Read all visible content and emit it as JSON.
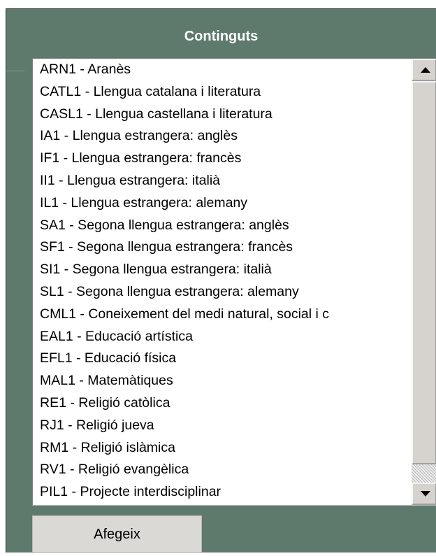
{
  "panel": {
    "title": "Continguts"
  },
  "list": {
    "items": [
      "ARN1 - Aranès",
      "CATL1 - Llengua catalana i literatura",
      "CASL1 - Llengua castellana i literatura",
      "IA1 - Llengua estrangera: anglès",
      "IF1 - Llengua estrangera: francès",
      "II1 - Llengua estrangera: italià",
      "IL1 - Llengua estrangera: alemany",
      "SA1 - Segona llengua estrangera: anglès",
      "SF1 - Segona llengua estrangera: francès",
      "SI1 - Segona llengua estrangera: italià",
      "SL1 - Segona llengua estrangera: alemany",
      "CML1 - Coneixement del medi natural, social i c",
      "EAL1 - Educació artística",
      "EFL1 - Educació física",
      "MAL1 - Matemàtiques",
      "RE1 - Religió catòlica",
      "RJ1 - Religió jueva",
      "RM1 - Religió islàmica",
      "RV1 - Religió evangèlica",
      "PIL1 - Projecte interdisciplinar"
    ]
  },
  "actions": {
    "add_label": "Afegeix"
  },
  "colors": {
    "panel_bg": "#5e7a6c",
    "title_text": "#ffffff",
    "button_bg": "#dad9d6"
  },
  "icons": {
    "scroll_up": "triangle-up",
    "scroll_down": "triangle-down"
  }
}
